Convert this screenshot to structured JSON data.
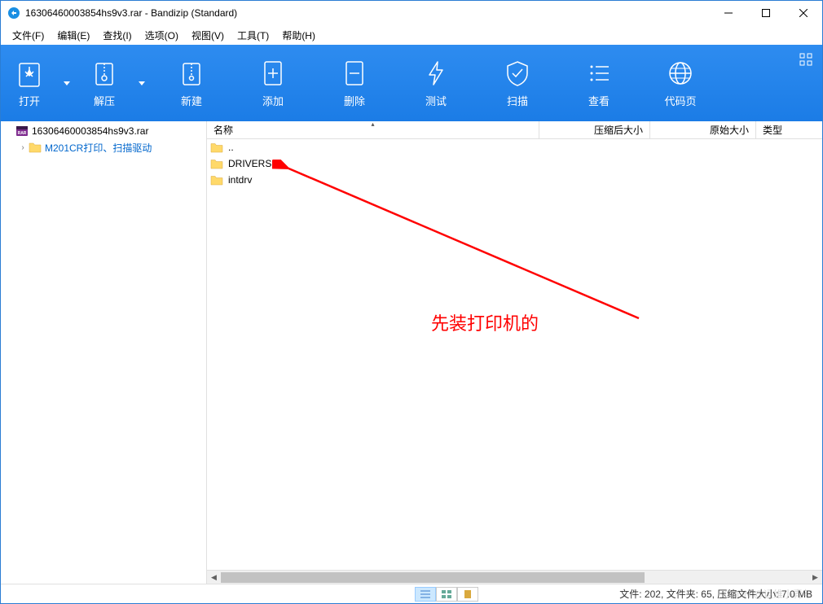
{
  "titlebar": {
    "title": "16306460003854hs9v3.rar - Bandizip (Standard)"
  },
  "window_controls": {
    "min": "minimize",
    "max": "maximize",
    "close": "close"
  },
  "menubar": [
    "文件(F)",
    "编辑(E)",
    "查找(I)",
    "选项(O)",
    "视图(V)",
    "工具(T)",
    "帮助(H)"
  ],
  "toolbar": [
    {
      "key": "open",
      "label": "打开",
      "split": true
    },
    {
      "key": "extract",
      "label": "解压",
      "split": true
    },
    {
      "key": "new",
      "label": "新建"
    },
    {
      "key": "add",
      "label": "添加"
    },
    {
      "key": "delete",
      "label": "删除"
    },
    {
      "key": "test",
      "label": "测试"
    },
    {
      "key": "scan",
      "label": "扫描"
    },
    {
      "key": "view",
      "label": "查看"
    },
    {
      "key": "codepage",
      "label": "代码页"
    }
  ],
  "tree": {
    "root_label": "16306460003854hs9v3.rar",
    "child1_label": "M201CR打印、扫描驱动"
  },
  "columns": {
    "name": "名称",
    "compressed": "压缩后大小",
    "original": "原始大小",
    "type": "类型"
  },
  "files": [
    {
      "name": ".."
    },
    {
      "name": "DRIVERS"
    },
    {
      "name": "intdrv"
    }
  ],
  "annotation": {
    "text": "先装打印机的"
  },
  "status": {
    "text": "文件: 202, 文件夹: 65, 压缩文件大小: 7.0 MB",
    "watermark": "CSDN @运维小青年"
  }
}
